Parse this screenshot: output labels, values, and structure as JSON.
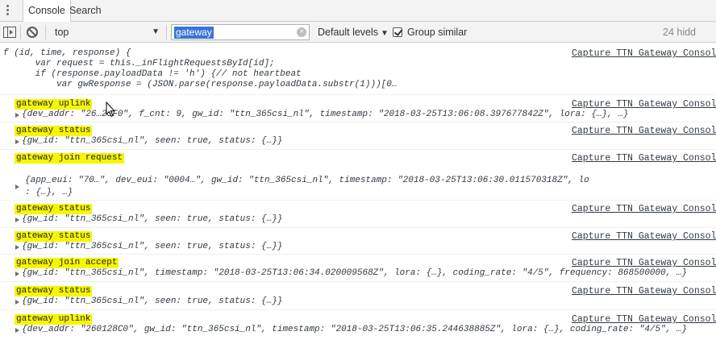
{
  "tabs": [
    {
      "label": "Console",
      "active": true
    },
    {
      "label": "Search",
      "active": false
    }
  ],
  "toolbar": {
    "context": "top",
    "filter_value": "gateway",
    "levels": "Default levels",
    "group_similar_label": "Group similar",
    "group_similar_checked": true,
    "hidden_count": "24 hidd"
  },
  "source_link": "Capture TTN Gateway Console",
  "function_preview": [
    "f (id, time, response) {",
    "      var request = this._inFlightRequestsById[id];",
    "      if (response.payloadData != 'h') {// not heartbeat",
    "          var gwResponse = (JSON.parse(response.payloadData.substr(1)))[0…"
  ],
  "messages": [
    {
      "label": "gateway uplink",
      "object": "{dev_addr: \"26…23F0\", f_cnt: 9, gw_id: \"ttn_365csi_nl\", timestamp: \"2018-03-25T13:06:08.397677842Z\", lora: {…}, …}"
    },
    {
      "label": "gateway status",
      "object": "{gw_id: \"ttn_365csi_nl\", seen: true, status: {…}}"
    },
    {
      "label": "gateway join request",
      "object_line1": "{app_eui: \"70…\", dev_eui: \"0004…\", gw_id: \"ttn_365csi_nl\", timestamp: \"2018-03-25T13:06:30.011570318Z\", lo",
      "object_line2": ": {…}, …}"
    },
    {
      "label": "gateway status",
      "object": "{gw_id: \"ttn_365csi_nl\", seen: true, status: {…}}"
    },
    {
      "label": "gateway status",
      "object": "{gw_id: \"ttn_365csi_nl\", seen: true, status: {…}}"
    },
    {
      "label": "gateway join accept",
      "object": "{gw_id: \"ttn_365csi_nl\", timestamp: \"2018-03-25T13:06:34.020009568Z\", lora: {…}, coding_rate: \"4/5\", frequency: 868500000, …}"
    },
    {
      "label": "gateway status",
      "object": "{gw_id: \"ttn_365csi_nl\", seen: true, status: {…}}"
    },
    {
      "label": "gateway uplink",
      "object": "{dev_addr: \"260128C0\", gw_id: \"ttn_365csi_nl\", timestamp: \"2018-03-25T13:06:35.244638885Z\", lora: {…}, coding_rate: \"4/5\", …}"
    }
  ]
}
